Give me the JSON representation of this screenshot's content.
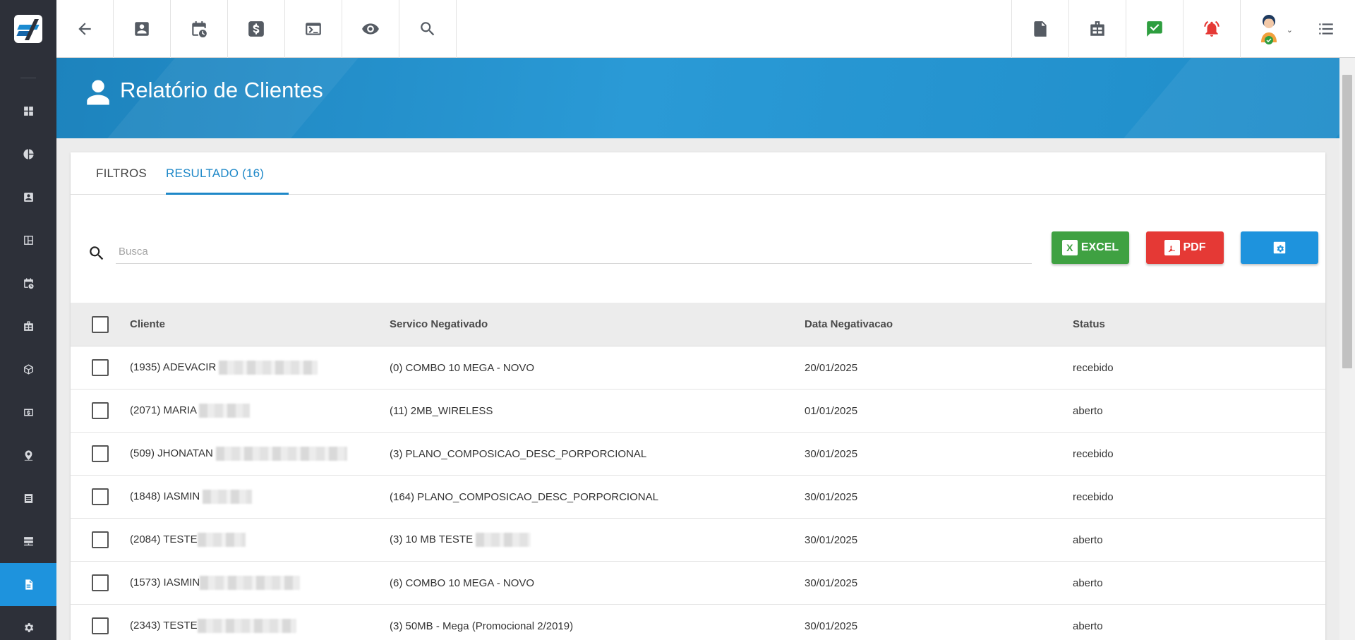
{
  "sidebar": {
    "items": [
      {
        "icon": "dashboard-icon"
      },
      {
        "icon": "pie-chart-icon"
      },
      {
        "icon": "contacts-icon"
      },
      {
        "icon": "board-icon"
      },
      {
        "icon": "calendar-clock-icon"
      },
      {
        "icon": "building-icon"
      },
      {
        "icon": "package-icon"
      },
      {
        "icon": "money-icon"
      },
      {
        "icon": "location-icon"
      },
      {
        "icon": "list-icon"
      },
      {
        "icon": "server-icon"
      },
      {
        "icon": "document-icon",
        "active": true
      },
      {
        "icon": "settings-icon"
      }
    ]
  },
  "topbar": {
    "left_icons": [
      "back-arrow-icon",
      "contact-card-icon",
      "calendar-clock-icon",
      "dollar-icon",
      "terminal-icon",
      "eye-icon",
      "search-icon"
    ],
    "right_icons": [
      "pdf-file-icon",
      "building-icon",
      "check-chat-icon",
      "alarm-bell-icon",
      "user-avatar",
      "menu-list-icon"
    ],
    "check_color": "#2e9e3f",
    "alarm_color": "#e53935"
  },
  "page": {
    "title": "Relatório de Clientes"
  },
  "tabs": [
    {
      "label": "FILTROS"
    },
    {
      "label": "RESULTADO (16)"
    }
  ],
  "search": {
    "placeholder": "Busca",
    "value": ""
  },
  "buttons": {
    "excel_label": "EXCEL",
    "excel_icon_text": "X",
    "pdf_label": "PDF",
    "colors": {
      "excel": "#3fa142",
      "pdf": "#e53935",
      "config": "#1e93dd"
    }
  },
  "table": {
    "headers": {
      "cliente": "Cliente",
      "servico": "Servico Negativado",
      "data": "Data Negativacao",
      "status": "Status"
    },
    "rows": [
      {
        "cliente": "(1935) ADEVACIR",
        "servico": "(0) COMBO 10 MEGA - NOVO",
        "data": "20/01/2025",
        "status": "recebido"
      },
      {
        "cliente": "(2071) MARIA",
        "servico": "(11) 2MB_WIRELESS",
        "data": "01/01/2025",
        "status": "aberto"
      },
      {
        "cliente": "(509) JHONATAN",
        "servico": "(3) PLANO_COMPOSICAO_DESC_PORPORCIONAL",
        "data": "30/01/2025",
        "status": "recebido"
      },
      {
        "cliente": "(1848) IASMIN",
        "servico": "(164) PLANO_COMPOSICAO_DESC_PORPORCIONAL",
        "data": "30/01/2025",
        "status": "recebido"
      },
      {
        "cliente": "(2084) TESTE",
        "servico": "(3) 10 MB TESTE",
        "data": "30/01/2025",
        "status": "aberto"
      },
      {
        "cliente": "(1573) IASMIN",
        "servico": "(6) COMBO 10 MEGA - NOVO",
        "data": "30/01/2025",
        "status": "aberto"
      },
      {
        "cliente": "(2343) TESTE",
        "servico": "(3) 50MB - Mega (Promocional 2/2019)",
        "data": "30/01/2025",
        "status": "aberto"
      }
    ]
  }
}
